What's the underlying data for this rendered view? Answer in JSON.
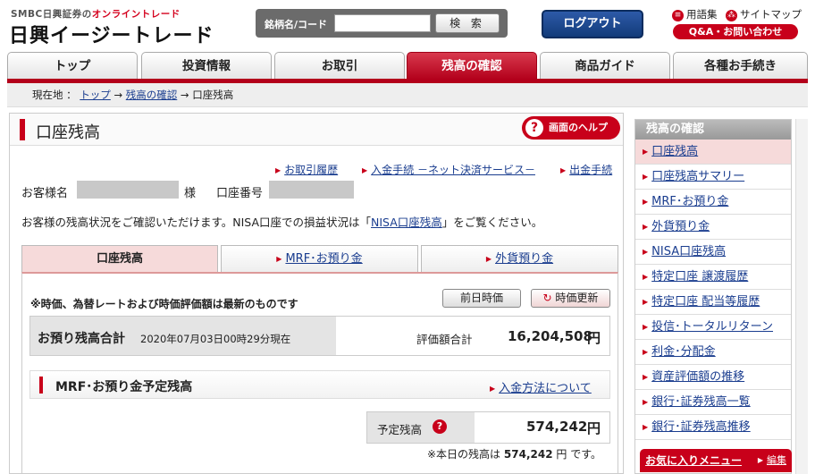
{
  "header": {
    "brand_prefix": "SMBC日興証券の",
    "brand_red": "オンライントレード",
    "brand_main": "日興イージートレード",
    "search_label": "銘柄名/コード",
    "search_value": "",
    "search_button": "検 索",
    "logout": "ログアウト",
    "glossary": "用語集",
    "sitemap": "サイトマップ",
    "qa": "Q&A・お問い合わせ"
  },
  "tabs": [
    {
      "label": "トップ"
    },
    {
      "label": "投資情報"
    },
    {
      "label": "お取引"
    },
    {
      "label": "残高の確認"
    },
    {
      "label": "商品ガイド"
    },
    {
      "label": "各種お手続き"
    }
  ],
  "breadcrumb": {
    "prefix": "現在地 ：",
    "top": "トップ",
    "arrow": "→",
    "balance": "残高の確認",
    "current": "口座残高"
  },
  "main": {
    "title": "口座残高",
    "help": "画面のヘルプ",
    "links": [
      "お取引履歴",
      "入金手続 －ネット決済サービス－",
      "出金手続"
    ],
    "customer_label": "お客様名",
    "sama": "様",
    "account_label": "口座番号",
    "notice_pre": "お客様の残高状況をご確認いただけます。NISA口座での損益状況は「",
    "notice_link": "NISA口座残高",
    "notice_post": "」をご覧ください。",
    "inner_tabs": [
      "口座残高",
      "MRF･お預り金",
      "外貨預り金"
    ],
    "note": "※時価、為替レートおよび時価評価額は最新のものです",
    "prev_day_btn": "前日時価",
    "refresh_btn": "時価更新",
    "total_label": "お預り残高合計",
    "total_date": "2020年07月03日00時29分現在",
    "valuation_label": "評価額合計",
    "valuation_value": "16,204,508",
    "yen": "円",
    "mrf_title": "MRF･お預り金予定残高",
    "deposit_method": "入金方法について",
    "sched_label": "予定残高",
    "sched_value": "574,242",
    "today_note": "※本日の残高は",
    "today_value": "574,242",
    "today_suffix": "円 です。"
  },
  "sidebar": {
    "title": "残高の確認",
    "items": [
      "口座残高",
      "口座残高サマリー",
      "MRF･お預り金",
      "外貨預り金",
      "NISA口座残高",
      "特定口座 譲渡履歴",
      "特定口座 配当等履歴",
      "投信･トータルリターン",
      "利金･分配金",
      "資産評価額の推移",
      "銀行･証券残高一覧",
      "銀行･証券残高推移"
    ],
    "favorites": "お気に入りメニュー",
    "edit": "編集"
  },
  "colors": {
    "brand_red": "#c8001a",
    "logout_blue": "#1f4a94"
  }
}
